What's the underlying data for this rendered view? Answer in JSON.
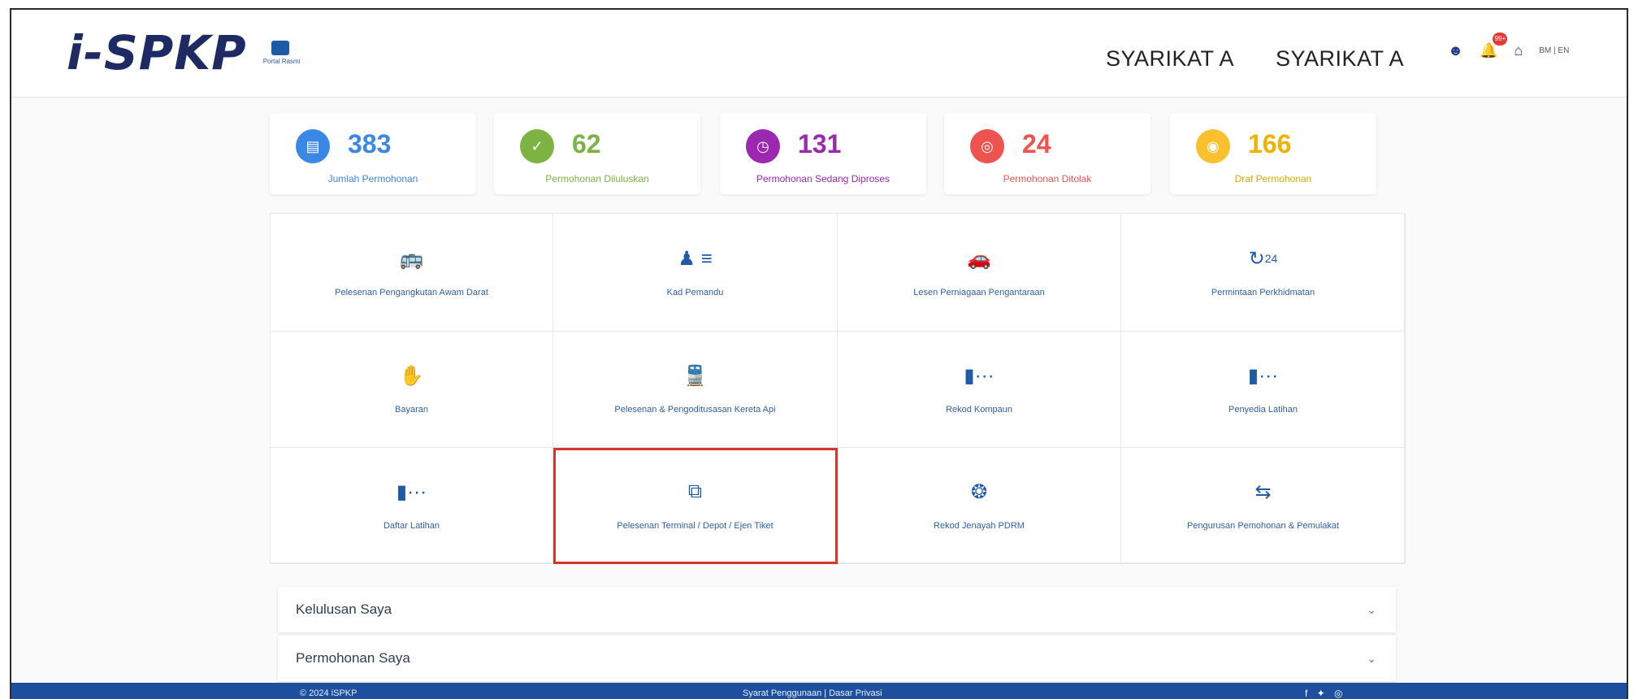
{
  "header": {
    "logo_text": "i-SPKP",
    "logo_subtext": "Portal Rasmi",
    "company_name_1": "SYARIKAT A",
    "company_name_2": "SYARIKAT A",
    "notification_count": "99+",
    "language": "BM | EN"
  },
  "stats": [
    {
      "value": "383",
      "label": "Jumlah Permohonan",
      "color": "#3b87e6",
      "icon": "document-icon"
    },
    {
      "value": "62",
      "label": "Permohonan Diluluskan",
      "color": "#7cb342",
      "icon": "check-circle-icon"
    },
    {
      "value": "131",
      "label": "Permohonan Sedang Diproses",
      "color": "#9c27b0",
      "icon": "clock-icon"
    },
    {
      "value": "24",
      "label": "Permohonan Ditolak",
      "color": "#ef5350",
      "icon": "cancel-icon"
    },
    {
      "value": "166",
      "label": "Draf Permohonan",
      "color": "#fbc02d",
      "icon": "draft-icon"
    }
  ],
  "tiles": [
    {
      "label": "Pelesenan Pengangkutan Awam Darat",
      "icon": "bus-car-icon"
    },
    {
      "label": "Kad Pemandu",
      "icon": "id-card-icon"
    },
    {
      "label": "Lesen Perniagaan Pengantaraan",
      "icon": "car-wifi-icon"
    },
    {
      "label": "Permintaan Perkhidmatan",
      "icon": "service-24-icon"
    },
    {
      "label": "Bayaran",
      "icon": "payment-hand-icon"
    },
    {
      "label": "Pelesenan & Pengoditusasan Kereta Api",
      "icon": "train-icon"
    },
    {
      "label": "Rekod Kompaun",
      "icon": "door-exit-icon"
    },
    {
      "label": "Penyedia Latihan",
      "icon": "door-exit-icon"
    },
    {
      "label": "Daftar Latihan",
      "icon": "door-exit-icon"
    },
    {
      "label": "Pelesenan Terminal / Depot / Ejen Tiket",
      "icon": "terminal-icon"
    },
    {
      "label": "Rekod Jenayah PDRM",
      "icon": "police-badge-icon"
    },
    {
      "label": "Pengurusan Pemohonan & Pemulakat",
      "icon": "management-icon"
    }
  ],
  "highlight_color": "#d9342b",
  "accordions": [
    {
      "title": "Kelulusan Saya"
    },
    {
      "title": "Permohonan Saya"
    }
  ],
  "footer": {
    "copyright": "© 2024 iSPKP",
    "links": "Syarat Penggunaan | Dasar Privasi",
    "social": "f ✦ ◎"
  }
}
